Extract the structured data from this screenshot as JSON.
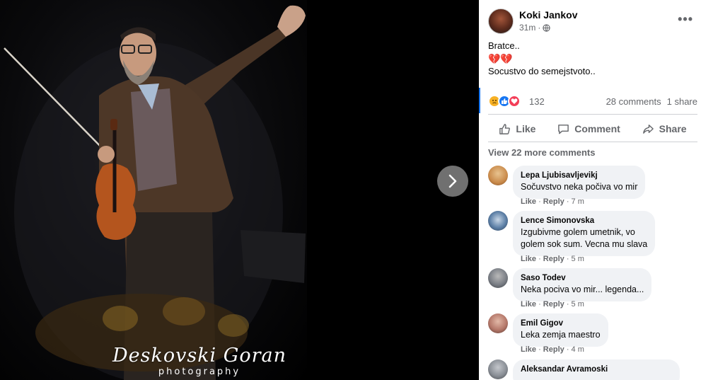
{
  "viewer": {
    "watermark_name": "Deskovski Goran",
    "watermark_sub": "photography",
    "next_icon": "chevron-right-icon"
  },
  "post": {
    "author": "Koki Jankov",
    "time": "31m",
    "audience_icon": "globe-icon",
    "text_line1": "Bratce..",
    "hearts": "💔💔",
    "text_line2": "Socustvo do semejstvoto..",
    "reactions": {
      "icons": [
        "sad",
        "like",
        "love"
      ],
      "count": "132"
    },
    "comments_count": "28 comments",
    "shares_count": "1 share"
  },
  "actions": {
    "like": "Like",
    "comment": "Comment",
    "share": "Share"
  },
  "view_more": "View 22 more comments",
  "comments": [
    {
      "name": "Lepa Ljubisavljevikj",
      "lines": [
        "Sočuvstvo neka počiva vo mir"
      ],
      "like": "Like",
      "reply": "Reply",
      "time": "7 m",
      "avatar_color": "#d9a46a"
    },
    {
      "name": "Lence Simonovska",
      "lines": [
        "Izgubivme golem umetnik, vo",
        "golem sok sum. Vecna mu slava"
      ],
      "like": "Like",
      "reply": "Reply",
      "time": "5 m",
      "avatar_color": "#5c7fa6"
    },
    {
      "name": "Saso Todev",
      "lines": [
        "Neka pociva vo mir... legenda..."
      ],
      "like": "Like",
      "reply": "Reply",
      "time": "5 m",
      "avatar_color": "#7b7f86"
    },
    {
      "name": "Emil Gigov",
      "lines": [
        "Leka zemja maestro"
      ],
      "like": "Like",
      "reply": "Reply",
      "time": "4 m",
      "avatar_color": "#b5786a"
    },
    {
      "name": "Aleksandar Avramoski",
      "lines": [
        ""
      ],
      "like": "",
      "reply": "",
      "time": "",
      "avatar_color": "#8a8f96"
    }
  ],
  "colors": {
    "accent": "#1877f2",
    "panel_bg": "#ffffff",
    "bubble_bg": "#f0f2f5",
    "secondary_text": "#65676b"
  }
}
